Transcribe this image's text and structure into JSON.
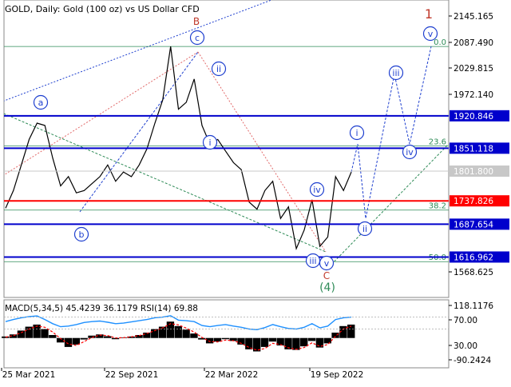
{
  "header": {
    "title": "GOLD, Daily:  Gold (100 oz) vs US Dollar CFD"
  },
  "colors": {
    "background": "#ffffff",
    "price": "#000000",
    "level_blue": "#0000cc",
    "level_red": "#ff0000",
    "fib_green": "#2e8b57",
    "wave_blue": "#1e3fcf",
    "wave_red": "#c0392b",
    "wave_green": "#2e8b57",
    "macd_hist": "#000000",
    "macd_signal": "#ff0000",
    "rsi": "#1e90ff"
  },
  "chart_data": [
    {
      "type": "line",
      "series": [
        {
          "values": [
            1722,
            1760,
            1815,
            1870,
            1905,
            1900,
            1830,
            1770,
            1790,
            1755,
            1760,
            1775,
            1790,
            1815,
            1780,
            1800,
            1790,
            1815,
            1850,
            1905,
            1955,
            2070,
            1935,
            1950,
            2000,
            1900,
            1860,
            1870,
            1845,
            1820,
            1805,
            1735,
            1720,
            1760,
            1780,
            1700,
            1725,
            1635,
            1675,
            1740,
            1640,
            1660,
            1790,
            1760,
            1800
          ]
        }
      ],
      "y_axis": {
        "ticks": [
          "2145.165",
          "2087.490",
          "2029.815",
          "1972.140",
          "1568.625"
        ],
        "range": [
          1530,
          2170
        ]
      },
      "x_axis": {
        "ticks": [
          "25 Mar 2021",
          "22 Sep 2021",
          "22 Mar 2022",
          "19 Sep 2022"
        ]
      },
      "price_levels": [
        {
          "value": 1920.846,
          "label": "1920.846",
          "kind": "blue"
        },
        {
          "value": 1851.118,
          "label": "1851.118",
          "kind": "blue"
        },
        {
          "value": 1801.8,
          "label": "1801.800",
          "kind": "current"
        },
        {
          "value": 1737.826,
          "label": "1737.826",
          "kind": "red"
        },
        {
          "value": 1687.654,
          "label": "1687.654",
          "kind": "blue"
        },
        {
          "value": 1616.962,
          "label": "1616.962",
          "kind": "blue"
        }
      ],
      "fibonacci": [
        {
          "level": "0.0",
          "price": 2070
        },
        {
          "level": "23.6",
          "price": 1856
        },
        {
          "level": "38.2",
          "price": 1718
        },
        {
          "level": "50.0",
          "price": 1607
        }
      ],
      "wave_labels": [
        {
          "text": "1",
          "style": "plain-red"
        },
        {
          "text": "B",
          "style": "plain-red"
        },
        {
          "text": "C",
          "style": "plain-red"
        },
        {
          "text": "c",
          "style": "circle-blue"
        },
        {
          "text": "a",
          "style": "circle-blue"
        },
        {
          "text": "b",
          "style": "circle-blue"
        },
        {
          "text": "ii",
          "style": "circle-blue"
        },
        {
          "text": "i",
          "style": "circle-blue"
        },
        {
          "text": "iv",
          "style": "circle-blue"
        },
        {
          "text": "iii",
          "style": "circle-blue"
        },
        {
          "text": "v",
          "style": "circle-blue"
        },
        {
          "text": "(4)",
          "style": "plain-green"
        },
        {
          "text": "i",
          "style": "circle-blue"
        },
        {
          "text": "ii",
          "style": "circle-blue"
        },
        {
          "text": "iii",
          "style": "circle-blue"
        },
        {
          "text": "iv",
          "style": "circle-blue"
        },
        {
          "text": "v",
          "style": "circle-blue"
        }
      ],
      "forecast_path": [
        1800,
        1860,
        1700,
        2010,
        1860,
        2070
      ]
    },
    {
      "type": "bar",
      "title": "MACD(5,34,5) 45.4239 36.1179 RSI(14) 69.88",
      "y_axis": {
        "ticks": [
          "118.1176",
          "70.00",
          "30.00",
          "-90.2424"
        ],
        "range": [
          -100,
          128
        ]
      },
      "macd_histogram": [
        5,
        12,
        25,
        38,
        45,
        30,
        10,
        -15,
        -30,
        -22,
        -5,
        8,
        12,
        6,
        -4,
        2,
        5,
        10,
        18,
        30,
        38,
        55,
        40,
        28,
        15,
        -5,
        -18,
        -12,
        -4,
        -10,
        -22,
        -38,
        -45,
        -30,
        -12,
        -25,
        -38,
        -40,
        -28,
        -10,
        -32,
        -18,
        18,
        40,
        45
      ],
      "macd_signal": [
        3,
        8,
        18,
        30,
        40,
        36,
        20,
        -2,
        -20,
        -25,
        -12,
        2,
        10,
        8,
        0,
        1,
        4,
        8,
        15,
        25,
        34,
        48,
        44,
        33,
        20,
        2,
        -12,
        -13,
        -7,
        -9,
        -18,
        -32,
        -41,
        -35,
        -18,
        -22,
        -33,
        -38,
        -32,
        -16,
        -28,
        -22,
        6,
        30,
        40
      ],
      "rsi": [
        55,
        62,
        68,
        72,
        74,
        62,
        48,
        38,
        40,
        45,
        52,
        55,
        57,
        53,
        48,
        50,
        54,
        58,
        62,
        68,
        70,
        75,
        60,
        58,
        55,
        42,
        38,
        42,
        45,
        40,
        36,
        30,
        28,
        35,
        45,
        38,
        32,
        30,
        36,
        48,
        34,
        40,
        62,
        68,
        70
      ]
    }
  ]
}
